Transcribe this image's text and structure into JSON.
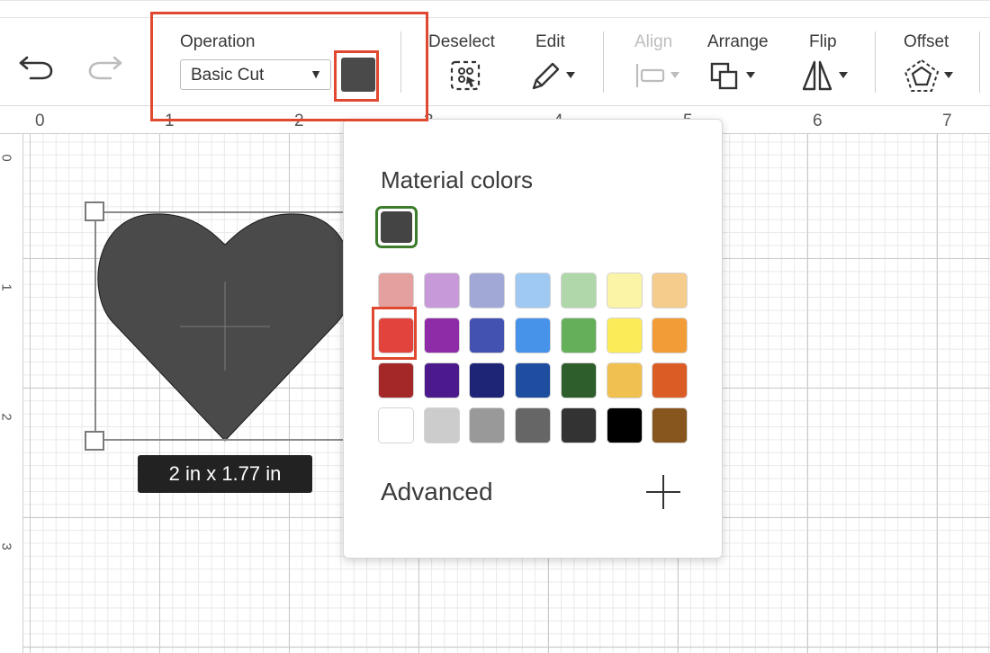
{
  "toolbar": {
    "undo_icon": "undo-icon",
    "redo_icon": "redo-icon",
    "operation_label": "Operation",
    "operation_value": "Basic Cut",
    "operation_color": "#4a4a4a",
    "deselect_label": "Deselect",
    "edit_label": "Edit",
    "align_label": "Align",
    "arrange_label": "Arrange",
    "flip_label": "Flip",
    "offset_label": "Offset"
  },
  "ruler": {
    "top": [
      "0",
      "1",
      "2",
      "3",
      "4",
      "5",
      "6",
      "7"
    ],
    "left": [
      "0",
      "1",
      "2",
      "3"
    ]
  },
  "canvas": {
    "selection_size": "2  in x 1.77  in",
    "shape_color": "#4a4a4a"
  },
  "color_popover": {
    "title": "Material colors",
    "current_color": "#444444",
    "rows": [
      [
        "#e49f9f",
        "#c899d8",
        "#a1a8d6",
        "#9fc9f3",
        "#afd7a9",
        "#fbf3a6",
        "#f6cc8d"
      ],
      [
        "#e2433d",
        "#8e2ba7",
        "#4351b1",
        "#4793ea",
        "#65af5b",
        "#fbeb59",
        "#f29c38"
      ],
      [
        "#a52828",
        "#4c1a8c",
        "#1e2476",
        "#1f4ea0",
        "#2d5e2b",
        "#f0c150",
        "#db5c25"
      ],
      [
        "#ffffff",
        "#cccccc",
        "#999999",
        "#666666",
        "#333333",
        "#000000",
        "#87561e"
      ]
    ],
    "advanced_label": "Advanced"
  },
  "highlight_color": "#e0482f"
}
